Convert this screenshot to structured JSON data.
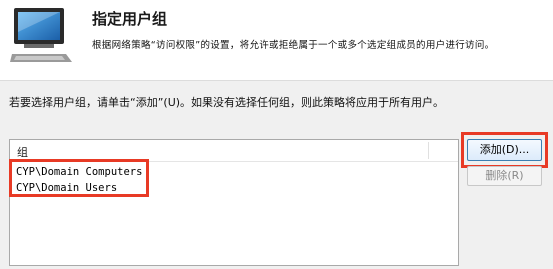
{
  "header": {
    "title": "指定用户组",
    "description": "根据网络策略“访问权限”的设置，将允许或拒绝属于一个或多个选定组成员的用户进行访问。"
  },
  "instruction": "若要选择用户组，请单击“添加”(U)。如果没有选择任何组，则此策略将应用于所有用户。",
  "group_list": {
    "column_header": "组",
    "rows": [
      "CYP\\Domain Computers",
      "CYP\\Domain Users"
    ]
  },
  "buttons": {
    "add_label": "添加(D)...",
    "remove_label": "删除(R)"
  },
  "icon": "network-monitor-icon",
  "colors": {
    "annotation": "#e83a25"
  }
}
